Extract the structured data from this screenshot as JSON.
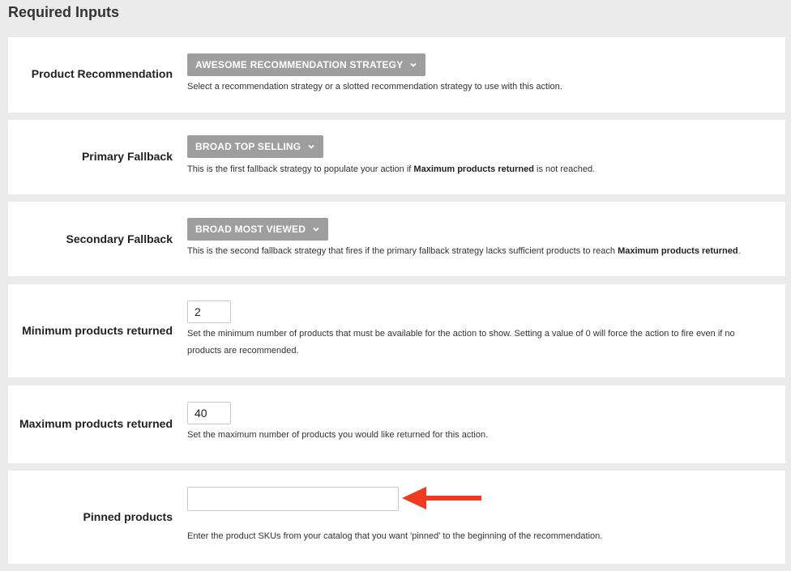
{
  "page": {
    "title": "Required Inputs"
  },
  "product_recommendation": {
    "label": "Product Recommendation",
    "button": "AWESOME RECOMMENDATION STRATEGY",
    "help": "Select a recommendation strategy or a slotted recommendation strategy to use with this action."
  },
  "primary_fallback": {
    "label": "Primary Fallback",
    "button": "BROAD TOP SELLING",
    "help_pre": "This is the first fallback strategy to populate your action if ",
    "help_bold": "Maximum products returned",
    "help_post": " is not reached."
  },
  "secondary_fallback": {
    "label": "Secondary Fallback",
    "button": "BROAD MOST VIEWED",
    "help_pre": "This is the second fallback strategy that fires if the primary fallback strategy lacks sufficient products to reach ",
    "help_bold": "Maximum products returned",
    "help_post": "."
  },
  "minimum_products": {
    "label": "Minimum products returned",
    "value": "2",
    "help": "Set the minimum number of products that must be available for the action to show. Setting a value of 0 will force the action to fire even if no products are recommended."
  },
  "maximum_products": {
    "label": "Maximum products returned",
    "value": "40",
    "help": "Set the maximum number of products you would like returned for this action."
  },
  "pinned_products": {
    "label": "Pinned products",
    "value": "",
    "help": "Enter the product SKUs from your catalog that you want 'pinned' to the beginning of the recommendation."
  },
  "colors": {
    "page_bg": "#ebebeb",
    "button_bg": "#9e9e9e",
    "arrow": "#ef3b1f"
  },
  "icons": {
    "dropdown": "chevron-down-icon",
    "annotation": "arrow-left-icon"
  }
}
